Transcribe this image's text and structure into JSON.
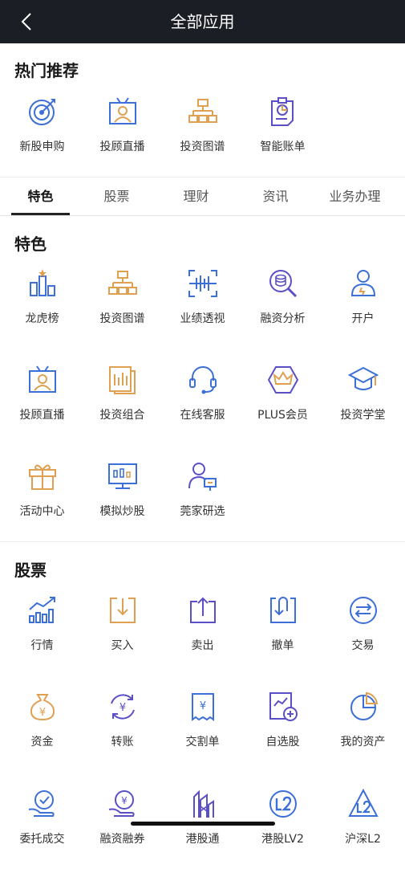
{
  "header": {
    "title": "全部应用",
    "back_icon": "back-arrow-icon"
  },
  "hot": {
    "title": "热门推荐",
    "items": [
      {
        "label": "新股申购",
        "icon": "target-icon"
      },
      {
        "label": "投顾直播",
        "icon": "tv-presenter-icon"
      },
      {
        "label": "投资图谱",
        "icon": "org-chart-icon"
      },
      {
        "label": "智能账单",
        "icon": "bill-chart-icon"
      }
    ]
  },
  "tabs": [
    {
      "label": "特色",
      "active": true
    },
    {
      "label": "股票"
    },
    {
      "label": "理财"
    },
    {
      "label": "资讯"
    },
    {
      "label": "业务办理"
    }
  ],
  "special": {
    "title": "特色",
    "items": [
      {
        "label": "龙虎榜",
        "icon": "ranking-bars-icon"
      },
      {
        "label": "投资图谱",
        "icon": "org-chart-icon"
      },
      {
        "label": "业绩透视",
        "icon": "scan-bars-icon"
      },
      {
        "label": "融资分析",
        "icon": "coins-magnifier-icon"
      },
      {
        "label": "开户",
        "icon": "user-account-icon"
      },
      {
        "label": "投顾直播",
        "icon": "tv-presenter-icon"
      },
      {
        "label": "投资组合",
        "icon": "portfolio-icon"
      },
      {
        "label": "在线客服",
        "icon": "headset-icon"
      },
      {
        "label": "PLUS会员",
        "icon": "crown-hexagon-icon"
      },
      {
        "label": "投资学堂",
        "icon": "graduation-cap-icon"
      },
      {
        "label": "活动中心",
        "icon": "gift-box-icon"
      },
      {
        "label": "模拟炒股",
        "icon": "candlestick-monitor-icon"
      },
      {
        "label": "莞家研选",
        "icon": "person-chart-icon"
      }
    ]
  },
  "stocks": {
    "title": "股票",
    "items": [
      {
        "label": "行情",
        "icon": "trend-bars-icon"
      },
      {
        "label": "买入",
        "icon": "buy-tray-icon"
      },
      {
        "label": "卖出",
        "icon": "sell-tray-icon"
      },
      {
        "label": "撤单",
        "icon": "cancel-order-icon"
      },
      {
        "label": "交易",
        "icon": "exchange-arrows-icon"
      },
      {
        "label": "资金",
        "icon": "money-bag-icon"
      },
      {
        "label": "转账",
        "icon": "transfer-icon"
      },
      {
        "label": "交割单",
        "icon": "receipt-icon"
      },
      {
        "label": "自选股",
        "icon": "add-watchlist-icon"
      },
      {
        "label": "我的资产",
        "icon": "pie-chart-icon"
      },
      {
        "label": "委托成交",
        "icon": "hand-check-icon"
      },
      {
        "label": "融资融券",
        "icon": "hand-yen-icon"
      },
      {
        "label": "港股通",
        "icon": "hk-building-icon"
      },
      {
        "label": "港股LV2",
        "icon": "l2-circle-icon"
      },
      {
        "label": "沪深L2",
        "icon": "l2-triangle-icon"
      }
    ]
  }
}
